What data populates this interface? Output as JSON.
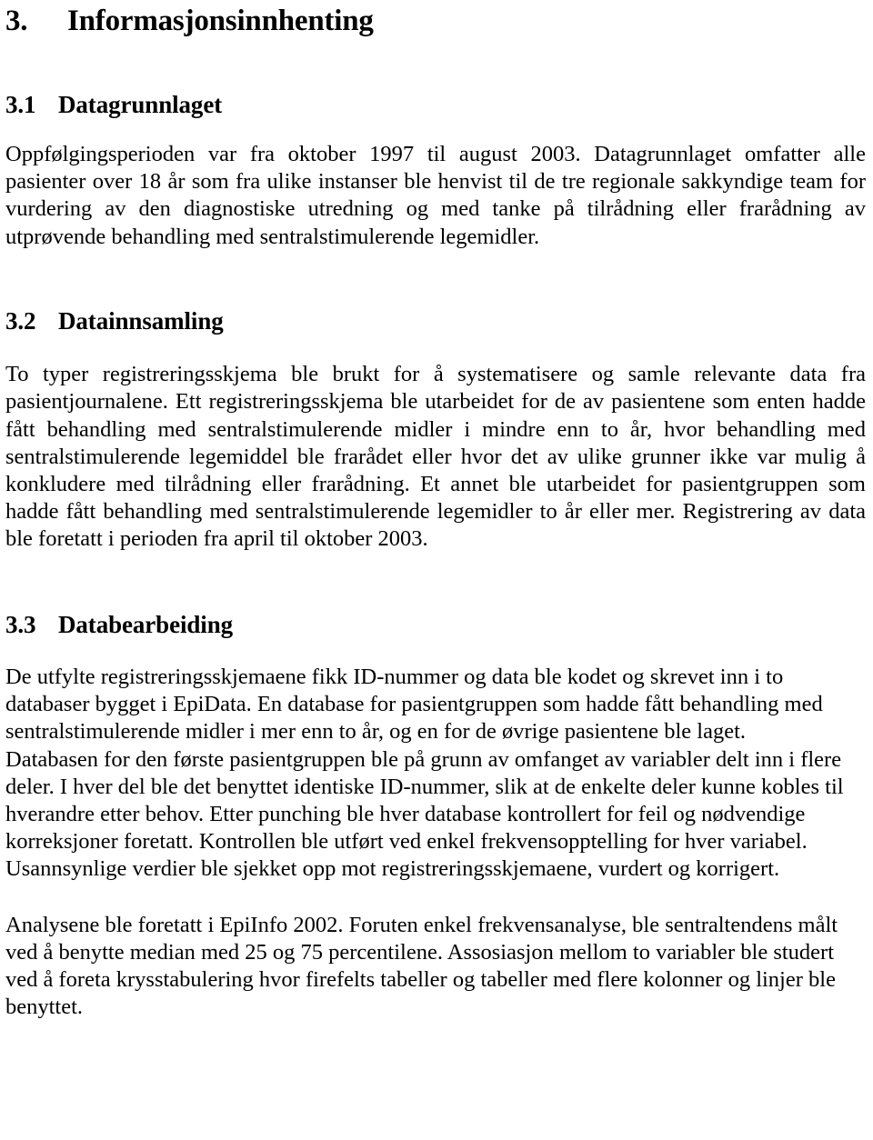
{
  "document": {
    "language": "Norwegian",
    "section_number": "3.",
    "section_title": "Informasjonsinnhenting"
  },
  "headings": {
    "main": {
      "number": "3.",
      "title": "Informasjonsinnhenting"
    },
    "sub1": {
      "number": "3.1",
      "title": "Datagrunnlaget"
    },
    "sub2": {
      "number": "3.2",
      "title": "Datainnsamling"
    },
    "sub3": {
      "number": "3.3",
      "title": "Databearbeiding"
    }
  },
  "paragraphs": {
    "datagrunnlaget": "Oppfølgingsperioden var fra oktober 1997 til august 2003. Datagrunnlaget omfatter alle pasienter over 18 år som fra ulike instanser ble henvist til de tre regionale sakkyndige team for vurdering av den diagnostiske utredning og med tanke på tilrådning eller frarådning av utprøvende behandling med sentralstimulerende legemidler.",
    "datainnsamling": "To typer registreringsskjema ble brukt for å systematisere og samle relevante data fra pasientjournalene. Ett registreringsskjema ble utarbeidet for de av pasientene som enten hadde fått behandling med sentralstimulerende midler i mindre enn to år, hvor behandling med sentralstimulerende legemiddel ble frarådet eller hvor det av ulike grunner ikke var mulig å konkludere med tilrådning eller frarådning. Et annet ble utarbeidet for pasientgruppen som hadde fått behandling med sentralstimulerende legemidler to år eller mer. Registrering av data ble foretatt i perioden fra april til oktober 2003.",
    "databearbeiding_1": "De utfylte registreringsskjemaene fikk ID-nummer og data ble kodet og skrevet inn i to databaser bygget i EpiData. En database for pasientgruppen som hadde fått behandling med sentralstimulerende midler i mer enn to år, og en for de øvrige pasientene ble laget.",
    "databearbeiding_2": "Databasen for den første pasientgruppen ble på grunn av omfanget av variabler delt inn i flere deler. I hver del ble det benyttet identiske ID-nummer, slik at de enkelte deler kunne kobles til hverandre etter behov. Etter punching ble hver database kontrollert for feil og nødvendige korreksjoner foretatt. Kontrollen ble utført ved enkel frekvensopptelling for hver variabel. Usannsynlige verdier ble sjekket opp mot registreringsskjemaene, vurdert og korrigert.",
    "analyse": "Analysene ble foretatt i EpiInfo 2002. Foruten enkel frekvensanalyse, ble sentraltendens målt ved å benytte median med 25 og 75 percentilene. Assosiasjon mellom to variabler ble studert ved å foreta krysstabulering hvor firefelts tabeller og tabeller med flere kolonner og linjer ble benyttet."
  }
}
